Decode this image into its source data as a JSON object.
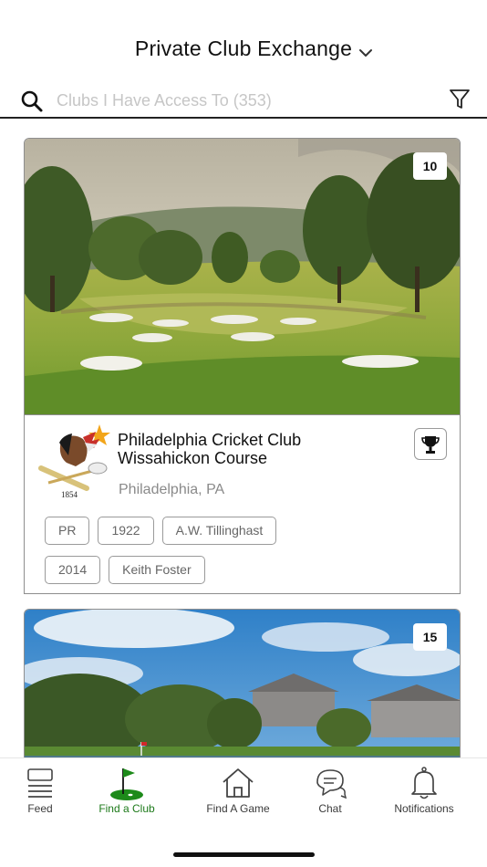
{
  "header": {
    "title": "Private Club Exchange",
    "chevron_icon": "chevron-down-icon"
  },
  "search": {
    "placeholder": "Clubs I Have Access To (353)",
    "value": "",
    "search_icon": "search-icon",
    "filter_icon": "filter-icon"
  },
  "clubs": [
    {
      "photo_count": "10",
      "name_line1": "Philadelphia Cricket Club",
      "name_line2": "Wissahickon Course",
      "location": "Philadelphia, PA",
      "logo_year": "1854",
      "tags_row1": [
        "PR",
        "1922",
        "A.W. Tillinghast"
      ],
      "tags_row2": [
        "2014",
        "Keith Foster"
      ],
      "trophy_icon": "trophy-icon"
    },
    {
      "photo_count": "15"
    }
  ],
  "tabbar": {
    "tabs": [
      {
        "label": "Feed",
        "icon": "feed-icon",
        "active": false
      },
      {
        "label": "Find a Club",
        "icon": "golf-flag-icon",
        "active": true
      },
      {
        "label": "Find A Game",
        "icon": "home-icon",
        "active": false
      },
      {
        "label": "Chat",
        "icon": "chat-icon",
        "active": false
      },
      {
        "label": "Notifications",
        "icon": "bell-icon",
        "active": false
      }
    ]
  },
  "colors": {
    "accent_green": "#1d7a1a",
    "border_gray": "#8e8e8e",
    "placeholder_gray": "#c6c6c6",
    "location_gray": "#8a8a8a"
  }
}
